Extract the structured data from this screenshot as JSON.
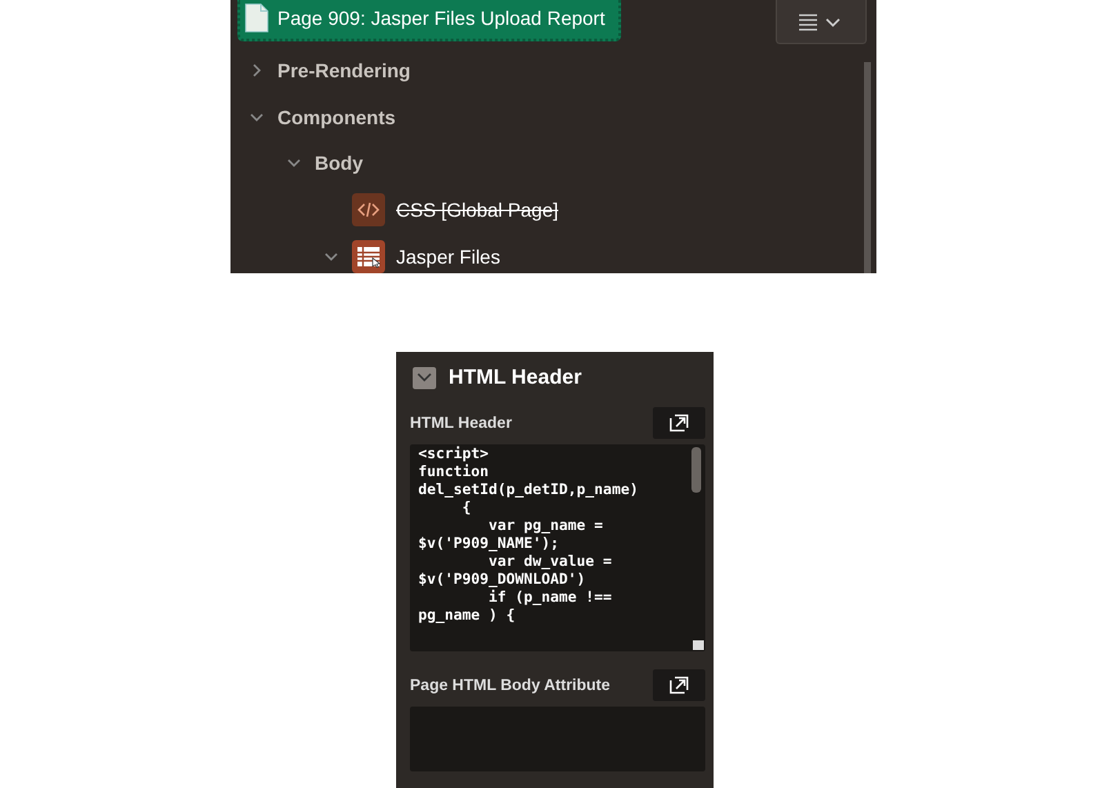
{
  "page_title": "Page 909: Jasper Files Upload Report",
  "tree": [
    {
      "label": "Pre-Rendering",
      "expanded": false,
      "kind": "group"
    },
    {
      "label": "Components",
      "expanded": true,
      "kind": "group",
      "children": [
        {
          "label": "Body",
          "expanded": true,
          "kind": "group",
          "children": [
            {
              "label": "CSS [Global Page]",
              "kind": "code",
              "disabled": true
            },
            {
              "label": "Jasper Files",
              "kind": "report",
              "expanded": true,
              "disabled": false
            }
          ]
        }
      ]
    }
  ],
  "section": {
    "title": "HTML Header",
    "expanded": true,
    "fields": [
      {
        "label": "HTML Header",
        "value": "<script>\nfunction\ndel_setId(p_detID,p_name)\n     {\n        var pg_name =\n$v('P909_NAME');\n        var dw_value =\n$v('P909_DOWNLOAD')\n        if (p_name !==\npg_name ) {"
      },
      {
        "label": "Page HTML Body Attribute"
      }
    ]
  }
}
